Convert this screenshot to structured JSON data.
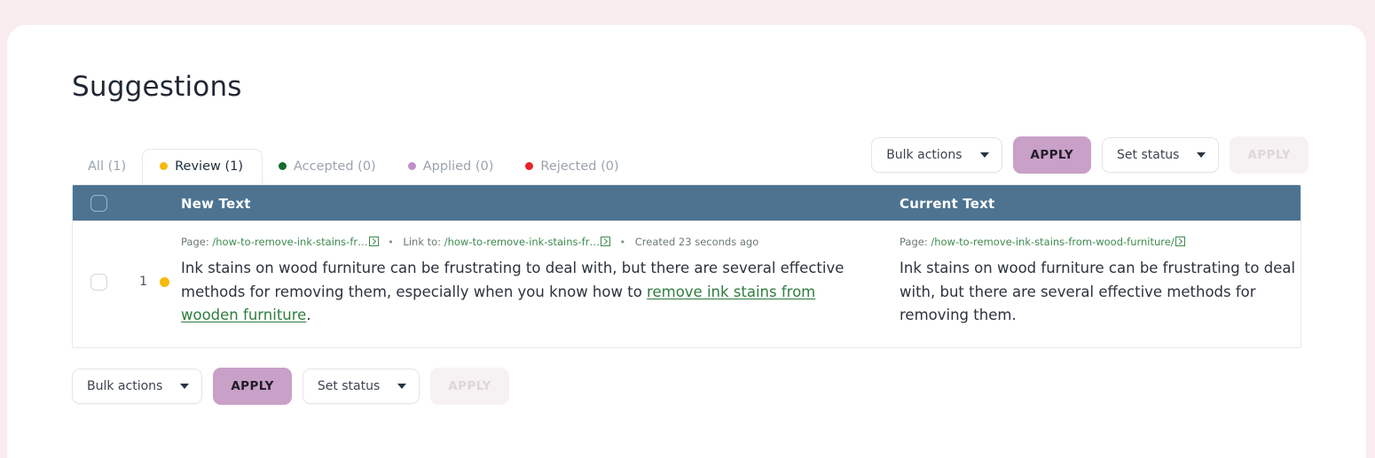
{
  "page": {
    "title": "Suggestions"
  },
  "tabs": [
    {
      "label": "All (1)",
      "dot": null,
      "active": false,
      "name": "tab-all"
    },
    {
      "label": "Review (1)",
      "dot": "#f5b90a",
      "active": true,
      "name": "tab-review"
    },
    {
      "label": "Accepted (0)",
      "dot": "#146c2e",
      "active": false,
      "name": "tab-accepted"
    },
    {
      "label": "Applied (0)",
      "dot": "#c08fcb",
      "active": false,
      "name": "tab-applied"
    },
    {
      "label": "Rejected (0)",
      "dot": "#e8222a",
      "active": false,
      "name": "tab-rejected"
    }
  ],
  "toolbar": {
    "bulk_actions_label": "Bulk actions",
    "bulk_apply_label": "APPLY",
    "set_status_label": "Set status",
    "status_apply_label": "APPLY"
  },
  "table": {
    "headers": {
      "new_text": "New Text",
      "current_text": "Current Text"
    },
    "rows": [
      {
        "number": "1",
        "status_color": "#f5b90a",
        "new": {
          "meta_page_label": "Page:",
          "meta_page_value": "/how-to-remove-ink-stains-fr…",
          "meta_link_label": "Link to:",
          "meta_link_value": "/how-to-remove-ink-stains-fr…",
          "meta_created": "Created 23 seconds ago",
          "text_before": "Ink stains on wood furniture can be frustrating to deal with, but there are several effective methods for removing them, especially when you know how to ",
          "link_text": "remove ink stains from wooden furniture",
          "text_after": "."
        },
        "current": {
          "meta_page_label": "Page:",
          "meta_page_value": "/how-to-remove-ink-stains-from-wood-furniture/",
          "text": "Ink stains on wood furniture can be frustrating to deal with, but there are several effective methods for removing them."
        }
      }
    ]
  },
  "bottom_toolbar": {
    "bulk_actions_label": "Bulk actions",
    "bulk_apply_label": "APPLY",
    "set_status_label": "Set status",
    "status_apply_label": "APPLY"
  },
  "colors": {
    "page_background": "#f8ecee",
    "card": "#ffffff",
    "table_header": "#4d7391",
    "apply_active": "#c8a0c8",
    "apply_disabled_bg": "#f6f2f4",
    "link_green": "#2f7d3f"
  }
}
